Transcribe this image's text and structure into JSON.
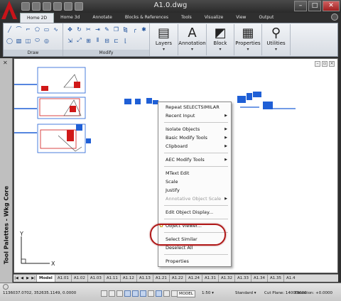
{
  "window": {
    "title": "A1.0.dwg"
  },
  "ribbon": {
    "tabs": [
      "Home 2D",
      "Home 3d",
      "Annotate",
      "Blocks & References",
      "Tools",
      "Visualize",
      "View",
      "Output"
    ],
    "active_tab": "Home 2D",
    "panels": {
      "draw_label": "Draw",
      "modify_label": "Modify"
    },
    "big_tools": [
      {
        "label": "Layers",
        "icon": "layers-icon"
      },
      {
        "label": "Annotation",
        "icon": "annotation-icon"
      },
      {
        "label": "Block",
        "icon": "block-icon"
      },
      {
        "label": "Properties",
        "icon": "properties-icon"
      },
      {
        "label": "Utilities",
        "icon": "utilities-icon"
      }
    ]
  },
  "palette": {
    "label": "Tool Palettes - Wkg Core"
  },
  "context_menu": {
    "items": [
      {
        "label": "Repeat SELECTSIMILAR",
        "type": "item"
      },
      {
        "label": "Recent Input",
        "type": "submenu"
      },
      {
        "type": "separator"
      },
      {
        "label": "Isolate Objects",
        "type": "submenu"
      },
      {
        "label": "Basic Modify Tools",
        "type": "submenu"
      },
      {
        "label": "Clipboard",
        "type": "submenu"
      },
      {
        "type": "separator"
      },
      {
        "label": "AEC Modify Tools",
        "type": "submenu"
      },
      {
        "type": "separator"
      },
      {
        "label": "MText Edit",
        "type": "item"
      },
      {
        "label": "Scale",
        "type": "item"
      },
      {
        "label": "Justify",
        "type": "item"
      },
      {
        "label": "Annotative Object Scale",
        "type": "submenu-disabled"
      },
      {
        "type": "separator"
      },
      {
        "label": "Edit Object Display...",
        "type": "item"
      },
      {
        "type": "separator"
      },
      {
        "label": "Object Viewer...",
        "type": "item-icon",
        "icon": "object-viewer-icon"
      },
      {
        "type": "separator"
      },
      {
        "label": "Select Similar",
        "type": "item"
      },
      {
        "label": "Deselect All",
        "type": "item"
      },
      {
        "type": "separator"
      },
      {
        "label": "Properties",
        "type": "item"
      }
    ],
    "highlighted": "Select Similar",
    "highlight_color": "#b01818"
  },
  "layout_tabs": [
    "Model",
    "A1.01",
    "A1.02",
    "A1.03",
    "A1.11",
    "A1.12",
    "A1.13",
    "A1.21",
    "A1.22",
    "A1.24",
    "A1.31",
    "A1.32",
    "A1.33",
    "A1.34",
    "A1.35",
    "A1.4"
  ],
  "active_layout": "Model",
  "statusbar": {
    "coords": "1136037.0702, 352635.1149, 0.0000",
    "model": "MODEL",
    "scale": "1:50",
    "visual_style": "Standard",
    "cut_plane_label": "Cut Plane:",
    "cut_plane_value": "1400.0000",
    "elevation_label": "Elevation:",
    "elevation_value": "+0.0000"
  },
  "ucs": {
    "x_label": "X",
    "y_label": "Y"
  },
  "colors": {
    "accent_red": "#c8141a",
    "drawing_blue": "#1f5fd6",
    "drawing_red": "#d01818"
  }
}
